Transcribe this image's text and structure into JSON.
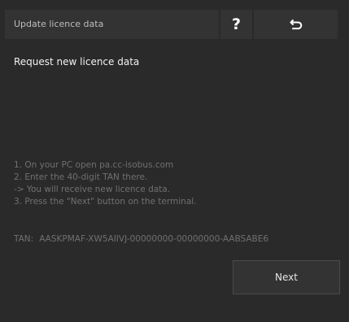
{
  "header": {
    "title": "Update licence data",
    "help_label": "?",
    "back_icon": "return-arrow-icon"
  },
  "main": {
    "heading": "Request new licence data",
    "instructions": [
      "1. On your PC open pa.cc-isobus.com",
      "2. Enter the 40-digit TAN there.",
      "-> You will receive new licence data.",
      "3. Press the \"Next\" button on the terminal."
    ],
    "tan_label": "TAN:",
    "tan_value": "AASKPMAF-XW5AIIVJ-00000000-00000000-AABSABE6"
  },
  "footer": {
    "next_label": "Next"
  },
  "colors": {
    "background": "#2a2a2a",
    "panel": "#333333",
    "muted_text": "#707070"
  }
}
